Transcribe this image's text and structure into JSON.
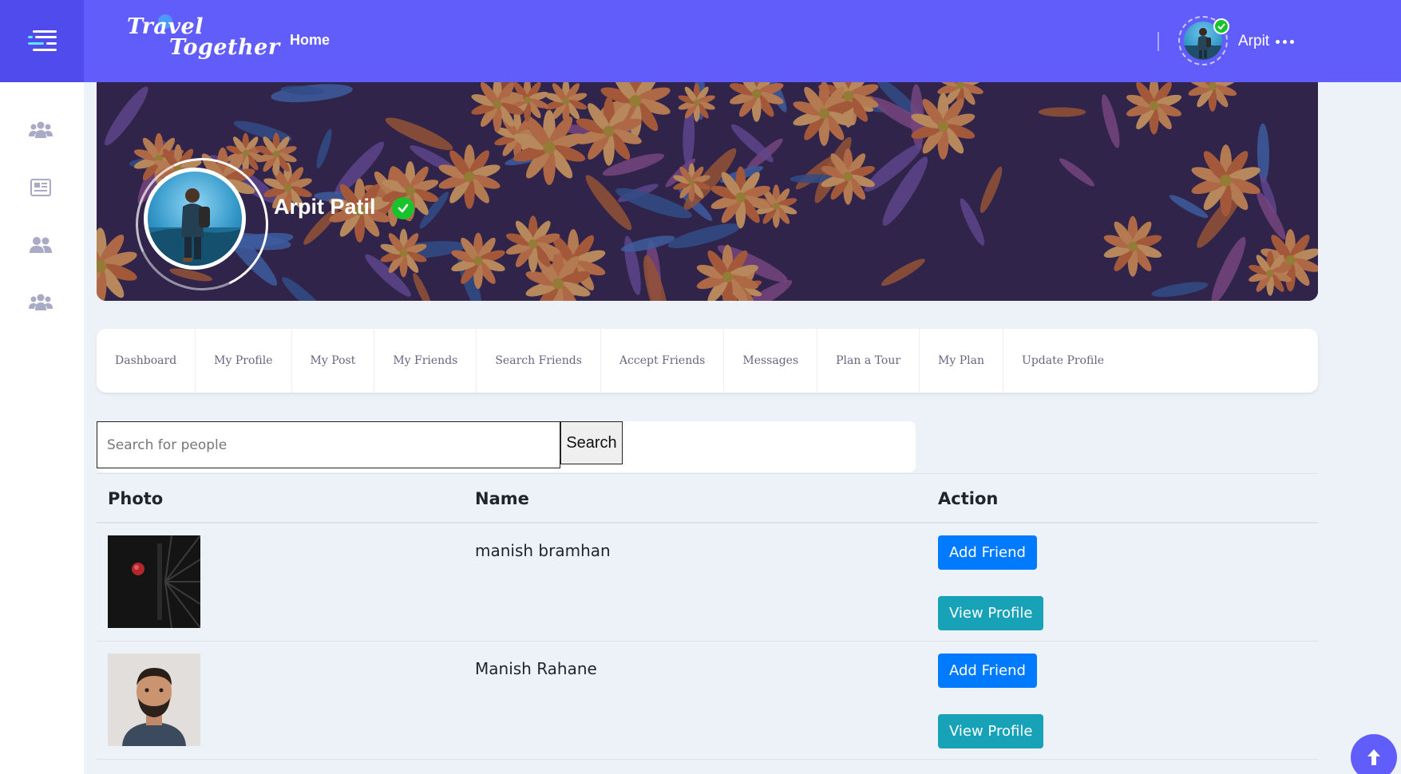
{
  "header": {
    "logo_line1": "Travel",
    "logo_line2": "Together",
    "home_label": "Home",
    "user_name": "Arpit"
  },
  "sidebar": {
    "items": [
      {
        "icon": "groups-icon"
      },
      {
        "icon": "newsfeed-icon"
      },
      {
        "icon": "friends-icon"
      },
      {
        "icon": "groups-icon"
      }
    ]
  },
  "profile": {
    "name": "Arpit Patil",
    "verified": true
  },
  "tabs": [
    {
      "label": "Dashboard"
    },
    {
      "label": "My Profile"
    },
    {
      "label": "My Post"
    },
    {
      "label": "My Friends"
    },
    {
      "label": "Search Friends"
    },
    {
      "label": "Accept Friends"
    },
    {
      "label": "Messages"
    },
    {
      "label": "Plan a Tour"
    },
    {
      "label": "My Plan"
    },
    {
      "label": "Update Profile"
    }
  ],
  "search": {
    "placeholder": "Search for people",
    "value": "",
    "button_label": "Search"
  },
  "table": {
    "headers": {
      "photo": "Photo",
      "name": "Name",
      "action": "Action"
    },
    "rows": [
      {
        "name": "manish bramhan",
        "add_label": "Add Friend",
        "view_label": "View Profile"
      },
      {
        "name": "Manish Rahane",
        "add_label": "Add Friend",
        "view_label": "View Profile"
      }
    ]
  },
  "colors": {
    "brand": "#615dfa",
    "add_button": "#007bff",
    "view_button": "#17a2b8",
    "verified": "#19c32b"
  }
}
